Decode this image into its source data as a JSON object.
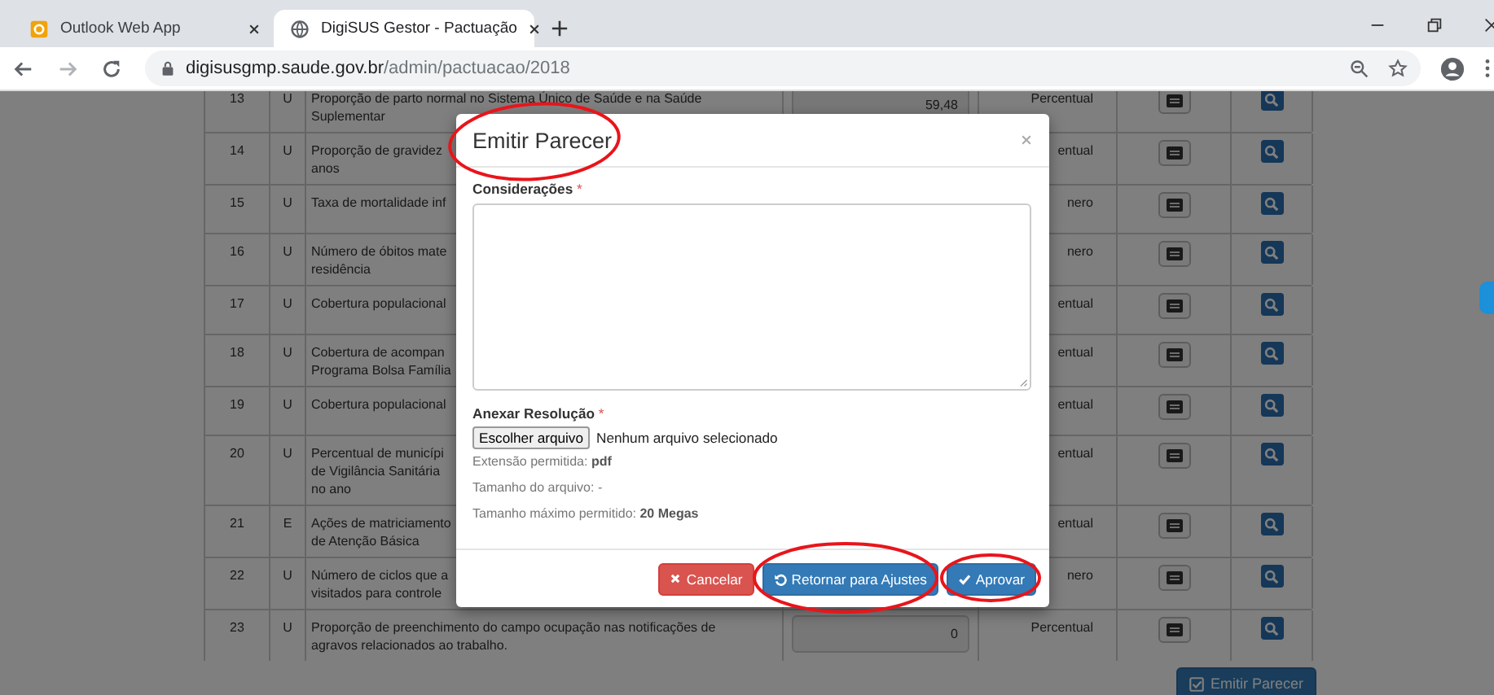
{
  "browser": {
    "tabs": [
      {
        "title": "Outlook Web App",
        "selected": false
      },
      {
        "title": "DigiSUS Gestor - Pactuação",
        "selected": true
      }
    ],
    "url": {
      "host": "digisusgmp.saude.gov.br",
      "path": "/admin/pactuacao/2018"
    }
  },
  "table": {
    "rows": [
      {
        "number": "13",
        "type": "U",
        "description": [
          "Proporção de parto normal no Sistema Único de Saúde e na Saúde",
          "Suplementar"
        ],
        "value": "59,48",
        "unit": "Percentual"
      },
      {
        "number": "14",
        "type": "U",
        "description": [
          "Proporção de gravidez",
          "anos"
        ],
        "unit": "entual"
      },
      {
        "number": "15",
        "type": "U",
        "description": [
          "Taxa de mortalidade inf"
        ],
        "unit": "nero"
      },
      {
        "number": "16",
        "type": "U",
        "description": [
          "Número de óbitos mate",
          "residência"
        ],
        "unit": "nero"
      },
      {
        "number": "17",
        "type": "U",
        "description": [
          "Cobertura populacional"
        ],
        "unit": "entual"
      },
      {
        "number": "18",
        "type": "U",
        "description": [
          "Cobertura de acompan",
          "Programa Bolsa Família"
        ],
        "unit": "entual"
      },
      {
        "number": "19",
        "type": "U",
        "description": [
          "Cobertura populacional"
        ],
        "unit": "entual"
      },
      {
        "number": "20",
        "type": "U",
        "description": [
          "Percentual de municípi",
          "de Vigilância Sanitária",
          "no ano"
        ],
        "unit": "entual"
      },
      {
        "number": "21",
        "type": "E",
        "description": [
          "Ações de matriciamento",
          "de Atenção Básica"
        ],
        "unit": "entual"
      },
      {
        "number": "22",
        "type": "U",
        "description": [
          "Número de ciclos que a",
          "visitados para controle"
        ],
        "unit": "nero"
      },
      {
        "number": "23",
        "type": "U",
        "description": [
          "Proporção de preenchimento do campo ocupação nas notificações de",
          "agravos relacionados ao trabalho."
        ],
        "value": "0",
        "unit": "Percentual"
      }
    ]
  },
  "page_button": "Emitir Parecer",
  "modal": {
    "title": "Emitir Parecer",
    "comment_label": {
      "text": "Considerações",
      "marker": "*"
    },
    "attach_label": {
      "text": "Anexar Resolução",
      "marker": "*"
    },
    "file_button": "Escolher arquivo",
    "file_status": "Nenhum arquivo selecionado",
    "info": [
      "Extensão permitida: **pdf**",
      "Tamanho do arquivo: -",
      "Tamanho máximo permitido: **20 Megas**"
    ],
    "buttons": [
      {
        "label": "Cancelar",
        "kind": "danger"
      },
      {
        "label": "Retornar para Ajustes",
        "kind": "primary"
      },
      {
        "label": "Aprovar",
        "kind": "primary"
      }
    ]
  }
}
